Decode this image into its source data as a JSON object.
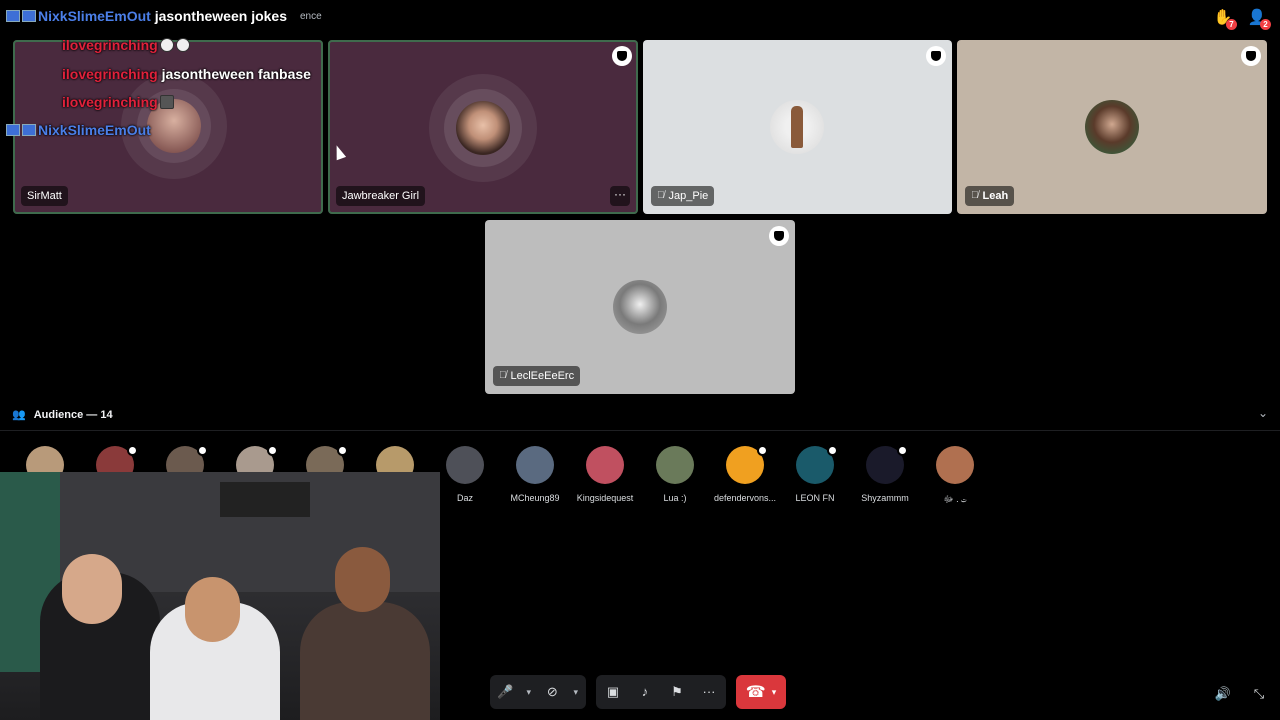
{
  "topbar": {
    "title": "ence",
    "icons": [
      {
        "name": "raised-hand-icon",
        "badge": "7"
      },
      {
        "name": "audience-request-icon",
        "badge": "2"
      }
    ]
  },
  "stage": {
    "speakers": [
      {
        "name": "SirMatt",
        "bg": "#4a2a3e",
        "speaking": true
      },
      {
        "name": "Jawbreaker Girl",
        "bg": "#4a2a3e",
        "speaking": true
      },
      {
        "name": "Jap_Pie",
        "bg": "#dcdfe1",
        "muted": true
      },
      {
        "name": "Leah",
        "bg": "#c2b5a6",
        "muted": true
      },
      {
        "name": "LeclEeEeErc",
        "bg": "#bdbdbd",
        "muted": true
      }
    ],
    "more_label": "···"
  },
  "audience": {
    "label": "Audience — 14",
    "members": [
      {
        "name": "",
        "color": "#b89a7a"
      },
      {
        "name": "",
        "color": "#8a3a3a"
      },
      {
        "name": "",
        "color": "#6b5a4e"
      },
      {
        "name": "",
        "color": "#a99a8e"
      },
      {
        "name": "",
        "color": "#7a6a58"
      },
      {
        "name": "",
        "color": "#b79a6a"
      },
      {
        "name": "Daz",
        "color": "#4e5058"
      },
      {
        "name": "MCheung89",
        "color": "#5a6a80"
      },
      {
        "name": "Kingsidequest",
        "color": "#c05060"
      },
      {
        "name": "Lua :)",
        "color": "#6a7a5a"
      },
      {
        "name": "defendervons...",
        "color": "#f0a020"
      },
      {
        "name": "LEON FN",
        "color": "#1a5a6a"
      },
      {
        "name": "Shyzammm",
        "color": "#1a1a2a"
      },
      {
        "name": "ت . ﷻ",
        "color": "#b07050"
      }
    ]
  },
  "chat": [
    {
      "user": "NixkSlimeEmOut",
      "msg": "jasontheween jokes",
      "user_color": "blue"
    },
    {
      "user": "ilovegrinching",
      "msg": "",
      "user_color": "red"
    },
    {
      "user": "ilovegrinching",
      "msg": "jasontheween fanbase",
      "user_color": "red"
    },
    {
      "user": "ilovegrinching",
      "msg": "",
      "user_color": "red"
    },
    {
      "user": "NixkSlimeEmOut",
      "msg": "",
      "user_color": "blue"
    }
  ],
  "controls": {
    "buttons": [
      "mic-icon",
      "camera-off-icon",
      "screen-share-icon",
      "soundboard-icon",
      "invite-icon",
      "more-icon",
      "hangup-icon"
    ]
  }
}
